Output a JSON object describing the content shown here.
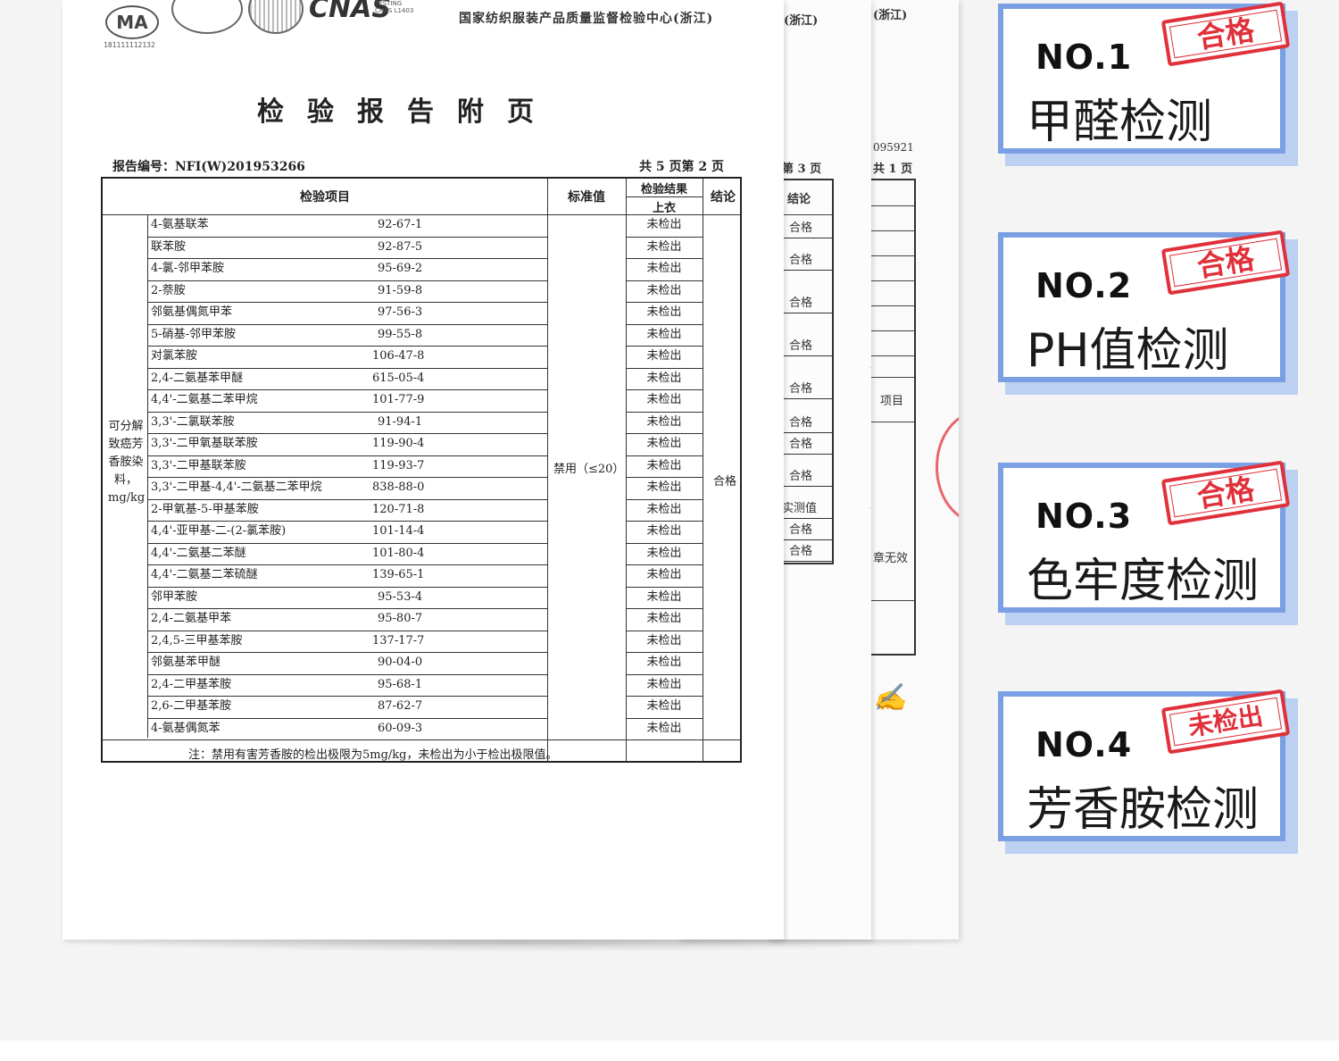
{
  "header": {
    "cert_ma": "MA",
    "cert_ma_code": "181111112132",
    "cnas": "CNAS",
    "cnas_sub": "TESTING\nCNAS L1403",
    "org_name": "国家纺织服装产品质量监督检验中心(浙江)"
  },
  "title": "检验报告附页",
  "report_number": "报告编号：NFI(W)201953266",
  "page_count": "共 5 页第 2 页",
  "table": {
    "col_item": "检验项目",
    "col_standard": "标准值",
    "col_result_top": "检验结果",
    "col_result_sub": "上衣",
    "col_conclusion": "结论",
    "category": "可分解致癌芳香胺染料，mg/kg",
    "standard_value": "禁用（≤20）",
    "conclusion_value": "合格",
    "rows": [
      {
        "name": "4-氨基联苯",
        "cas": "92-67-1",
        "result": "未检出"
      },
      {
        "name": "联苯胺",
        "cas": "92-87-5",
        "result": "未检出"
      },
      {
        "name": "4-氯-邻甲苯胺",
        "cas": "95-69-2",
        "result": "未检出"
      },
      {
        "name": "2-萘胺",
        "cas": "91-59-8",
        "result": "未检出"
      },
      {
        "name": "邻氨基偶氮甲苯",
        "cas": "97-56-3",
        "result": "未检出"
      },
      {
        "name": "5-硝基-邻甲苯胺",
        "cas": "99-55-8",
        "result": "未检出"
      },
      {
        "name": "对氯苯胺",
        "cas": "106-47-8",
        "result": "未检出"
      },
      {
        "name": "2,4-二氨基苯甲醚",
        "cas": "615-05-4",
        "result": "未检出"
      },
      {
        "name": "4,4'-二氨基二苯甲烷",
        "cas": "101-77-9",
        "result": "未检出"
      },
      {
        "name": "3,3'-二氯联苯胺",
        "cas": "91-94-1",
        "result": "未检出"
      },
      {
        "name": "3,3'-二甲氧基联苯胺",
        "cas": "119-90-4",
        "result": "未检出"
      },
      {
        "name": "3,3'-二甲基联苯胺",
        "cas": "119-93-7",
        "result": "未检出"
      },
      {
        "name": "3,3'-二甲基-4,4'-二氨基二苯甲烷",
        "cas": "838-88-0",
        "result": "未检出"
      },
      {
        "name": "2-甲氧基-5-甲基苯胺",
        "cas": "120-71-8",
        "result": "未检出"
      },
      {
        "name": "4,4'-亚甲基-二-(2-氯苯胺)",
        "cas": "101-14-4",
        "result": "未检出"
      },
      {
        "name": "4,4'-二氨基二苯醚",
        "cas": "101-80-4",
        "result": "未检出"
      },
      {
        "name": "4,4'-二氨基二苯硫醚",
        "cas": "139-65-1",
        "result": "未检出"
      },
      {
        "name": "邻甲苯胺",
        "cas": "95-53-4",
        "result": "未检出"
      },
      {
        "name": "2,4-二氨基甲苯",
        "cas": "95-80-7",
        "result": "未检出"
      },
      {
        "name": "2,4,5-三甲基苯胺",
        "cas": "137-17-7",
        "result": "未检出"
      },
      {
        "name": "邻氨基苯甲醚",
        "cas": "90-04-0",
        "result": "未检出"
      },
      {
        "name": "2,4-二甲基苯胺",
        "cas": "95-68-1",
        "result": "未检出"
      },
      {
        "name": "2,6-二甲基苯胺",
        "cas": "87-62-7",
        "result": "未检出"
      },
      {
        "name": "4-氨基偶氮苯",
        "cas": "60-09-3",
        "result": "未检出"
      }
    ],
    "footnote": "注：禁用有害芳香胺的检出极限为5mg/kg，未检出为小于检出极限值。"
  },
  "back_pages": {
    "page3_header": "第 3 页",
    "page3_col": "结论",
    "page3_cells": [
      "合格",
      "合格",
      "合格",
      "合格",
      "合格",
      "合格",
      "合格",
      "合格",
      "实测值",
      "合格",
      "合格"
    ],
    "page1_code": "095921",
    "page1_header": "共 1 页",
    "page1_item": "项目",
    "page1_invalid": "章无效"
  },
  "badges": [
    {
      "no": "NO.1",
      "label": "甲醛检测",
      "stamp": "合格"
    },
    {
      "no": "NO.2",
      "label": "PH值检测",
      "stamp": "合格"
    },
    {
      "no": "NO.3",
      "label": "色牢度检测",
      "stamp": "合格"
    },
    {
      "no": "NO.4",
      "label": "芳香胺检测",
      "stamp": "未检出"
    }
  ],
  "colors": {
    "badge_border": "#7a9fe2",
    "stamp_red": "#e0313b"
  }
}
